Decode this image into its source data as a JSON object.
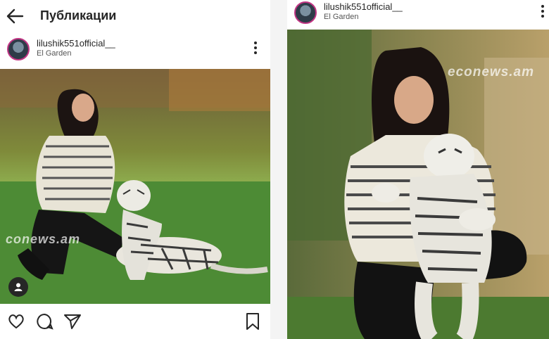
{
  "left": {
    "header": {
      "title": "Публикации"
    },
    "post": {
      "username": "lilushik551official__",
      "location": "El Garden"
    },
    "watermark": "conews.am"
  },
  "right": {
    "post": {
      "username": "lilushik551official__",
      "location": "El Garden"
    },
    "watermark": "econews.am"
  },
  "icons": {
    "back": "arrow-left-icon",
    "more": "vertical-dots-icon",
    "tag": "user-tag-icon",
    "like": "heart-icon",
    "comment": "comment-icon",
    "share": "send-icon",
    "save": "bookmark-icon"
  },
  "colors": {
    "text": "#262626",
    "avatar_ring": "#c13584",
    "grass": "#5e9a3a"
  }
}
